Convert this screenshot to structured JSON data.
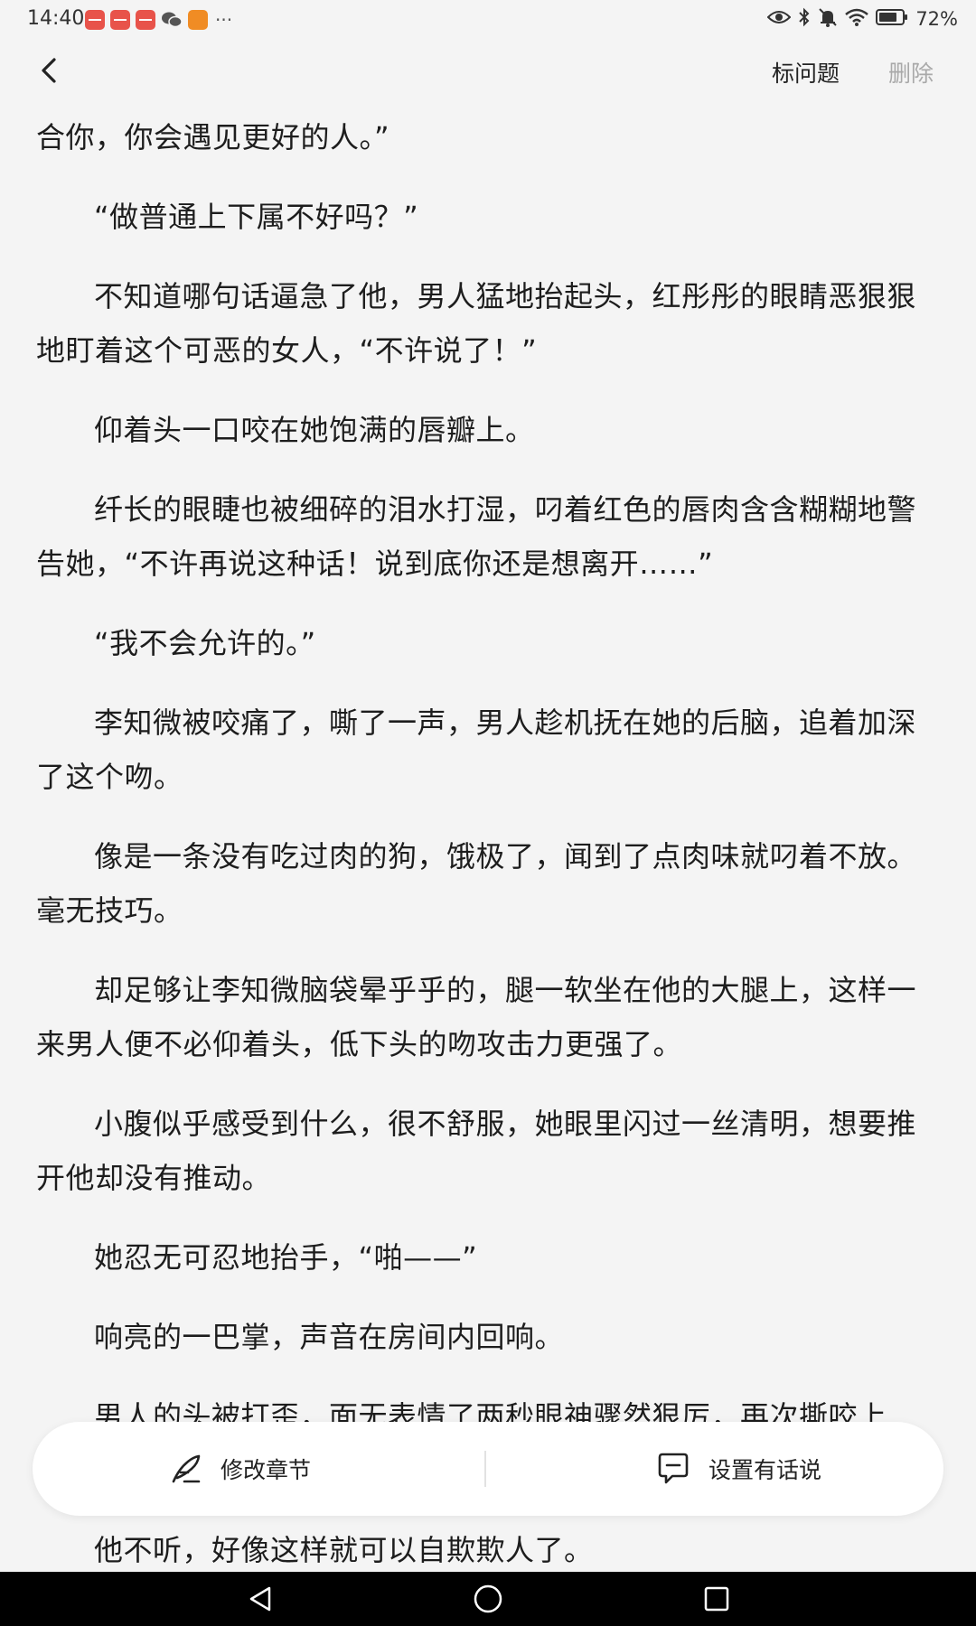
{
  "status_bar": {
    "time": "14:40",
    "more": "···",
    "battery": "72%"
  },
  "header": {
    "report_label": "标问题",
    "delete_label": "删除"
  },
  "article": {
    "paragraphs": [
      "合你，你会遇见更好的人。”",
      "“做普通上下属不好吗？”",
      "不知道哪句话逼急了他，男人猛地抬起头，红彤彤的眼睛恶狠狠地盯着这个可恶的女人，“不许说了！”",
      "仰着头一口咬在她饱满的唇瓣上。",
      "纤长的眼睫也被细碎的泪水打湿，叼着红色的唇肉含含糊糊地警告她，“不许再说这种话！说到底你还是想离开……”",
      "“我不会允许的。”",
      "李知微被咬痛了，嘶了一声，男人趁机抚在她的后脑，追着加深了这个吻。",
      "像是一条没有吃过肉的狗，饿极了，闻到了点肉味就叼着不放。毫无技巧。",
      "却足够让李知微脑袋晕乎乎的，腿一软坐在他的大腿上，这样一来男人便不必仰着头，低下头的吻攻击力更强了。",
      "小腹似乎感受到什么，很不舒服，她眼里闪过一丝清明，想要推开他却没有推动。",
      "她忍无可忍地抬手，“啪——”",
      "响亮的一巴掌，声音在房间内回响。",
      "男人的头被打歪，面无表情了两秒眼神骤然狠厉，再次撕咬上去。",
      "他不听，好像这样就可以自欺欺人了。"
    ]
  },
  "action_bar": {
    "edit_label": "修改章节",
    "say_label": "设置有话说"
  }
}
